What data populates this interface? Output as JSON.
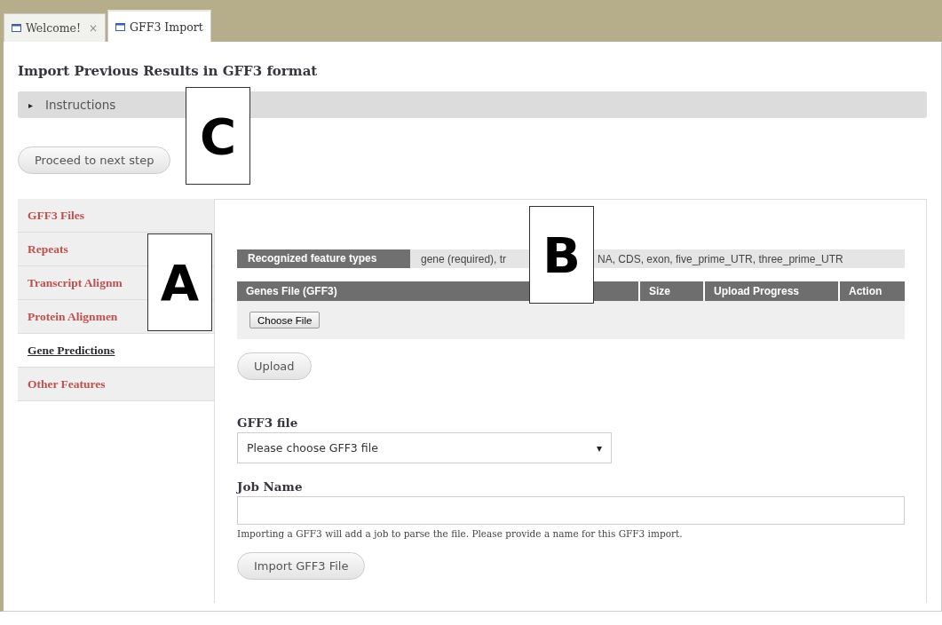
{
  "tabs": [
    {
      "label": "Welcome!",
      "close": "×",
      "selected": false
    },
    {
      "label": "GFF3 Import",
      "selected": true
    }
  ],
  "heading": "Import Previous Results in GFF3 format",
  "instructions": {
    "arrow": "▸",
    "label": "Instructions",
    "expanded": false
  },
  "proceed_button": "Proceed to next step",
  "sidebar": {
    "items": [
      {
        "label": "GFF3 Files",
        "selected": false
      },
      {
        "label": "Repeats",
        "selected": false
      },
      {
        "label": "Transcript Alignm",
        "selected": false
      },
      {
        "label": "Protein Alignmen",
        "selected": false
      },
      {
        "label": "Gene Predictions",
        "selected": true
      },
      {
        "label": "Other Features",
        "selected": false
      }
    ]
  },
  "feature_types": {
    "label": "Recognized feature types",
    "value_start": "gene (required), tr",
    "value_end": "NA, CDS, exon, five_prime_UTR, three_prime_UTR"
  },
  "upload_table": {
    "columns": [
      "Genes File (GFF3)",
      "Size",
      "Upload Progress",
      "Action"
    ],
    "choose_button": "Choose File"
  },
  "upload_button": "Upload",
  "gff3_file": {
    "label": "GFF3 file",
    "value": "Please choose GFF3 file",
    "caret": "▾"
  },
  "job_name": {
    "label": "Job Name",
    "help": "Importing a GFF3 will add a job to parse the file. Please provide a name for this GFF3 import."
  },
  "import_button": "Import GFF3 File",
  "callouts": [
    {
      "letter": "C",
      "kind": "c"
    },
    {
      "letter": "A",
      "kind": "a"
    },
    {
      "letter": "B",
      "kind": "b"
    }
  ]
}
